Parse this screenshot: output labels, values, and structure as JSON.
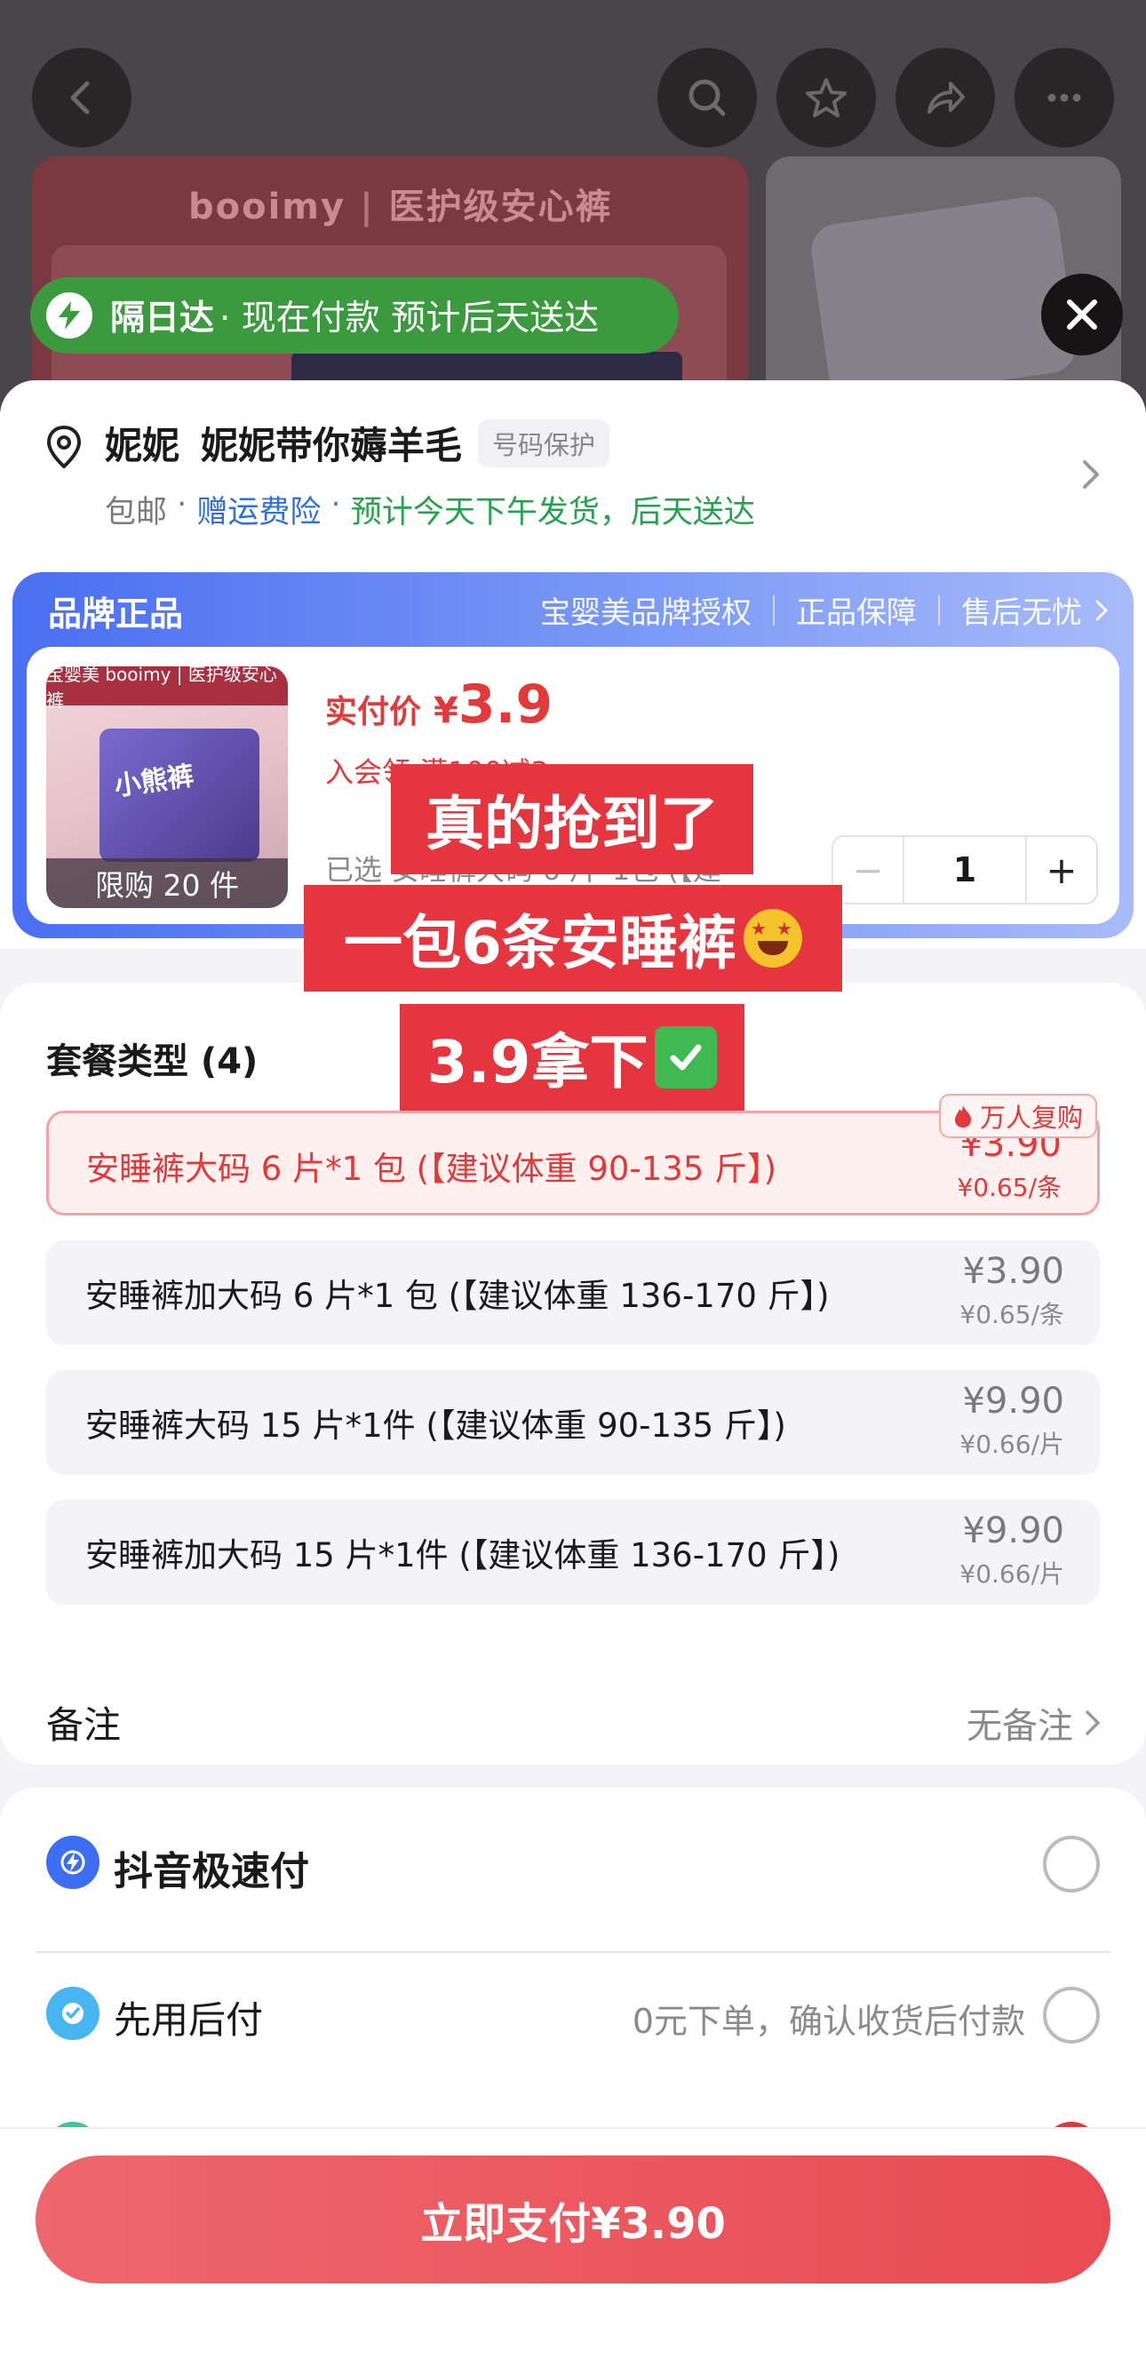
{
  "background": {
    "brand_text": "booimy",
    "brand_tagline": "医护级安心裤"
  },
  "delivery": {
    "badge": "隔日达",
    "text": "· 现在付款 预计后天送达"
  },
  "address": {
    "name": "妮妮",
    "address_text": "妮妮带你薅羊毛",
    "privacy_tag": "号码保护",
    "free_shipping": "包邮",
    "insurance": "赠运费险",
    "ship_estimate": "预计今天下午发货，后天送达"
  },
  "brand_box": {
    "title": "品牌正品",
    "tags": [
      "宝婴美品牌授权",
      "正品保障",
      "售后无忧"
    ]
  },
  "product": {
    "thumb_strip": "宝婴美 booimy | 医护级安心裤",
    "thumb_label": "小熊裤",
    "limit": "限购 20 件",
    "price_label": "实付价",
    "price_symbol": "¥",
    "price_value": "3.9",
    "coupon": "入会领 满100减3 >",
    "selected": "已选 安睡裤大码 6 片*1包 (【建",
    "quantity": "1",
    "minus": "−",
    "plus": "+"
  },
  "packages": {
    "title": "套餐类型 (4)",
    "hot_badge": "万人复购",
    "options": [
      {
        "label": "安睡裤大码 6 片*1 包 (【建议体重 90-135 斤】)",
        "price": "¥3.90",
        "unit": "¥0.65/条"
      },
      {
        "label": "安睡裤加大码 6 片*1 包 (【建议体重 136-170 斤】)",
        "price": "¥3.90",
        "unit": "¥0.65/条"
      },
      {
        "label": "安睡裤大码 15 片*1件 (【建议体重 90-135 斤】)",
        "price": "¥9.90",
        "unit": "¥0.66/片"
      },
      {
        "label": "安睡裤加大码 15 片*1件 (【建议体重 136-170 斤】)",
        "price": "¥9.90",
        "unit": "¥0.66/片"
      }
    ]
  },
  "note": {
    "label": "备注",
    "value": "无备注"
  },
  "payment": {
    "methods": [
      {
        "name": "抖音极速付",
        "desc": ""
      },
      {
        "name": "先用后付",
        "desc": "0元下单，确认收货后付款"
      }
    ]
  },
  "pay_button": "立即支付¥3.90",
  "captions": {
    "line1": "真的抢到了",
    "line2": "一包6条安睡裤",
    "line3": "3.9拿下"
  },
  "colors": {
    "accent_red": "#e23a3a",
    "brand_blue": "#4a6ff1",
    "delivery_green": "#3a9a3d",
    "pay_button": "#e94b54"
  }
}
